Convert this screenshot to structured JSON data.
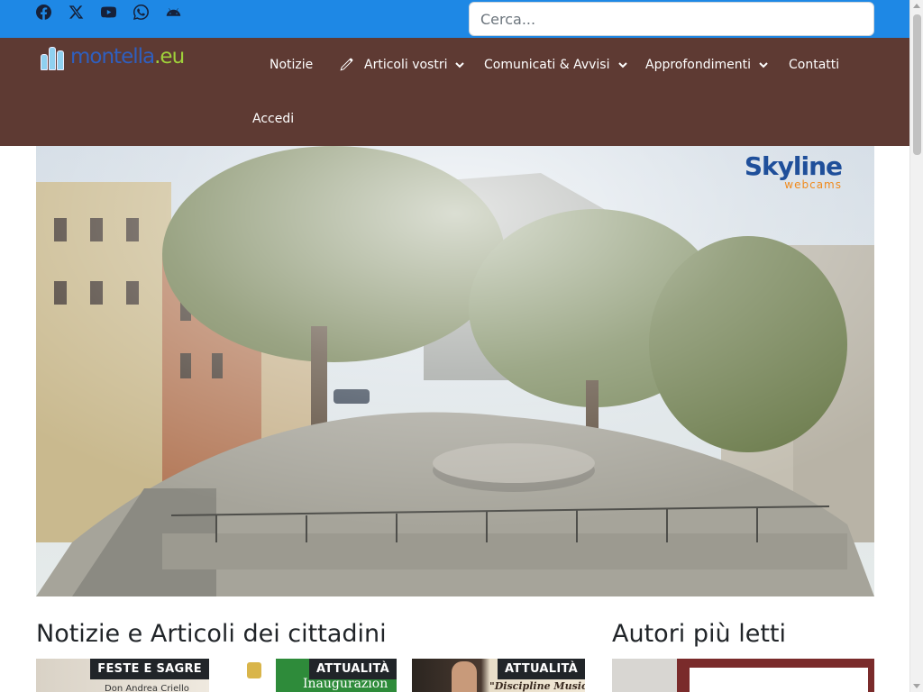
{
  "social": {
    "icons": [
      "facebook-icon",
      "x-twitter-icon",
      "youtube-icon",
      "whatsapp-icon",
      "android-icon"
    ]
  },
  "search": {
    "placeholder": "Cerca..."
  },
  "brand": {
    "part1": "montella",
    "part2": ".eu"
  },
  "nav": {
    "items": [
      {
        "label": "Notizie"
      },
      {
        "label": "Articoli vostri",
        "icon": "pencil-icon",
        "dropdown": true
      },
      {
        "label": "Comunicati & Avvisi",
        "dropdown": true
      },
      {
        "label": "Approfondimenti",
        "dropdown": true
      },
      {
        "label": "Contatti"
      },
      {
        "label": "Accedi"
      }
    ]
  },
  "hero": {
    "watermark": {
      "brand": "Skyline",
      "sub": "webcams"
    }
  },
  "sections": {
    "news_title": "Notizie e Articoli dei cittadini",
    "authors_title": "Autori più letti"
  },
  "cards": [
    {
      "badge": "FESTE E SAGRE",
      "caption": "Don Andrea Criello"
    },
    {
      "badge": "ATTUALITÀ",
      "caption": "Inaugurazion"
    },
    {
      "badge": "ATTUALITÀ",
      "caption": "\"Discipline Musicali"
    }
  ],
  "colors": {
    "topbar": "#1e88e5",
    "navbar": "#5e3a33",
    "badge": "#212529"
  }
}
